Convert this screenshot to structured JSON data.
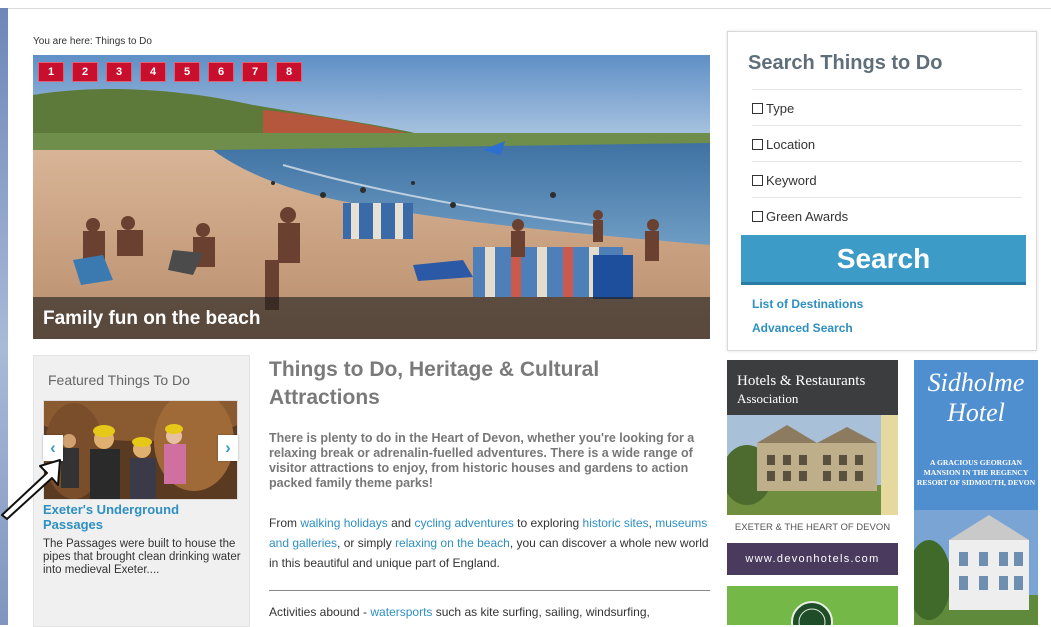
{
  "breadcrumb": "You are here: Things to Do",
  "slideshow": {
    "pages": [
      "1",
      "2",
      "3",
      "4",
      "5",
      "6",
      "7",
      "8"
    ],
    "caption": "Family fun on the beach"
  },
  "search_panel": {
    "title": "Search Things to Do",
    "filters": [
      "Type",
      "Location",
      "Keyword",
      "Green Awards"
    ],
    "button_label": "Search",
    "links": [
      "List of Destinations",
      "Advanced Search"
    ]
  },
  "featured": {
    "heading": "Featured Things To Do",
    "prev_label": "‹",
    "next_label": "›",
    "item_title": "Exeter's Underground Passages",
    "item_desc": "The Passages were built to house the pipes that brought clean drinking water into medieval Exeter...."
  },
  "main": {
    "heading": "Things to Do, Heritage & Cultural Attractions",
    "intro": "There is plenty to do in the Heart of Devon, whether you're looking for a relaxing break or adrenalin-fuelled adventures. There is a wide range of visitor attractions to enjoy, from historic houses and gardens to action packed family theme parks!",
    "para": {
      "t1": "From ",
      "link1": "walking holidays",
      "t2": " and ",
      "link2": "cycling adventures",
      "t3": " to exploring ",
      "link3": "historic sites",
      "t4": ", ",
      "link4": "museums and galleries",
      "t5": ", or simply ",
      "link5": "relaxing on the beach",
      "t6": ", you can discover a whole new world in this beautiful and unique part of England."
    },
    "activities": {
      "t1": "Activities abound - ",
      "link1": "watersports",
      "t2": " such as kite surfing, sailing, windsurfing,"
    }
  },
  "ads": {
    "hotels": {
      "name": "Hotels & Restaurants",
      "sub": "Association",
      "tagline": "EXETER & THE HEART OF DEVON",
      "website": "www.devonhotels.com"
    },
    "sidholme": {
      "name": "Sidholme Hotel",
      "copy": "A GRACIOUS GEORGIAN MANSION IN THE REGENCY RESORT OF SIDMOUTH, DEVON"
    }
  },
  "colors": {
    "accent_red": "#c8102e",
    "link_blue": "#2e8fc1",
    "search_button": "#3d9bc8",
    "heading_grey": "#7a7a7a"
  }
}
